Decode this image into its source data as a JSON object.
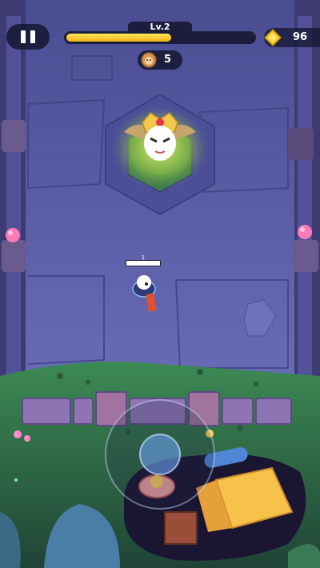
{
  "hud": {
    "level_label": "Lv.2",
    "xp_progress": 0.56,
    "coins": "96",
    "kills": "5"
  },
  "player": {
    "hp_label": "1",
    "hp_fraction": 1.0
  },
  "colors": {
    "xp_fill": "#f2b51a",
    "floor": "#5b5fa6",
    "grass": "#2f6b48",
    "hud_bg": "#1c1d3d"
  },
  "icons": {
    "pause": "pause-icon",
    "coin": "gem-coin-icon",
    "kill": "monster-kill-icon",
    "boss": "boss-portrait-icon"
  }
}
